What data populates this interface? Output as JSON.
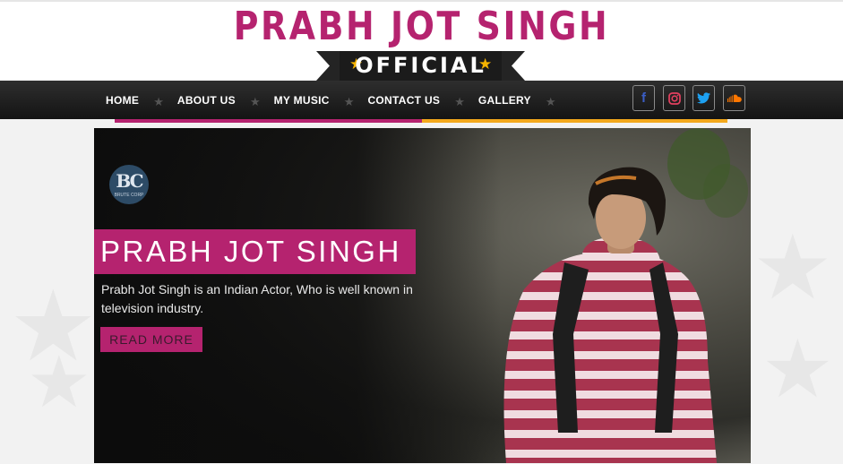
{
  "header": {
    "title": "PRABH JOT SINGH",
    "ribbon": "OFFICIAL"
  },
  "nav": {
    "items": [
      {
        "label": "HOME"
      },
      {
        "label": "ABOUT US"
      },
      {
        "label": "MY MUSIC"
      },
      {
        "label": "CONTACT US"
      },
      {
        "label": "GALLERY"
      }
    ]
  },
  "social": [
    {
      "name": "facebook-icon",
      "glyph": "f"
    },
    {
      "name": "instagram-icon",
      "glyph": ""
    },
    {
      "name": "twitter-icon",
      "glyph": ""
    },
    {
      "name": "soundcloud-icon",
      "glyph": ""
    }
  ],
  "hero": {
    "watermark_letters": "BC",
    "watermark_sub": "BRUTE CORP",
    "title": "PRABH JOT SINGH",
    "description": "Prabh Jot Singh is an Indian Actor, Who is well known in television industry.",
    "button": "READ MORE"
  },
  "colors": {
    "brand_pink": "#b5236f",
    "accent_gold": "#f3a81c",
    "nav_dark": "#1a1a1a"
  }
}
